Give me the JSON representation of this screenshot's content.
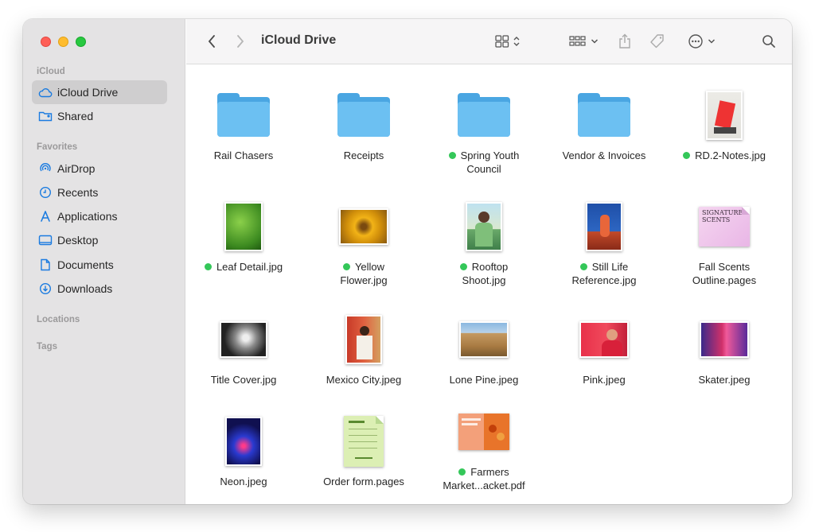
{
  "window": {
    "title": "iCloud Drive"
  },
  "sidebar": {
    "sections": [
      {
        "heading": "iCloud"
      },
      {
        "heading": "Favorites"
      },
      {
        "heading": "Locations"
      },
      {
        "heading": "Tags"
      }
    ],
    "items": [
      {
        "label": "iCloud Drive",
        "icon": "cloud-icon",
        "selected": true
      },
      {
        "label": "Shared",
        "icon": "shared-folder-icon"
      },
      {
        "label": "AirDrop",
        "icon": "airdrop-icon"
      },
      {
        "label": "Recents",
        "icon": "clock-icon"
      },
      {
        "label": "Applications",
        "icon": "applications-icon"
      },
      {
        "label": "Desktop",
        "icon": "desktop-icon"
      },
      {
        "label": "Documents",
        "icon": "document-icon"
      },
      {
        "label": "Downloads",
        "icon": "download-icon"
      }
    ]
  },
  "toolbar": {
    "title": "iCloud Drive",
    "buttons": [
      "back-icon",
      "forward-icon",
      "view-grid-icon",
      "group-icon",
      "share-icon",
      "tag-icon",
      "more-icon",
      "search-icon"
    ]
  },
  "files": [
    {
      "name": "Rail Chasers",
      "kind": "folder",
      "synced": false
    },
    {
      "name": "Receipts",
      "kind": "folder",
      "synced": false
    },
    {
      "name": "Spring Youth Council",
      "kind": "folder",
      "synced": true
    },
    {
      "name": "Vendor & Invoices",
      "kind": "folder",
      "synced": false
    },
    {
      "name": "RD.2-Notes.jpg",
      "kind": "image",
      "synced": true
    },
    {
      "name": "Leaf Detail.jpg",
      "kind": "image",
      "synced": true
    },
    {
      "name": "Yellow Flower.jpg",
      "kind": "image",
      "synced": true
    },
    {
      "name": "Rooftop Shoot.jpg",
      "kind": "image",
      "synced": true
    },
    {
      "name": "Still Life Reference.jpg",
      "kind": "image",
      "synced": true
    },
    {
      "name": "Fall Scents Outline.pages",
      "kind": "pages",
      "synced": false,
      "thumb_text": "SIGNATURE SCENTS"
    },
    {
      "name": "Title Cover.jpg",
      "kind": "image",
      "synced": false
    },
    {
      "name": "Mexico City.jpeg",
      "kind": "image",
      "synced": false
    },
    {
      "name": "Lone Pine.jpeg",
      "kind": "image",
      "synced": false
    },
    {
      "name": "Pink.jpeg",
      "kind": "image",
      "synced": false
    },
    {
      "name": "Skater.jpeg",
      "kind": "image",
      "synced": false
    },
    {
      "name": "Neon.jpeg",
      "kind": "image",
      "synced": false
    },
    {
      "name": "Order form.pages",
      "kind": "pages",
      "synced": false
    },
    {
      "name": "Farmers Market...acket.pdf",
      "kind": "pdf",
      "synced": true
    }
  ],
  "colors": {
    "sync_dot": "#34c759",
    "folder": "#6cc0f2",
    "sidebar_icon": "#1a7be0"
  }
}
